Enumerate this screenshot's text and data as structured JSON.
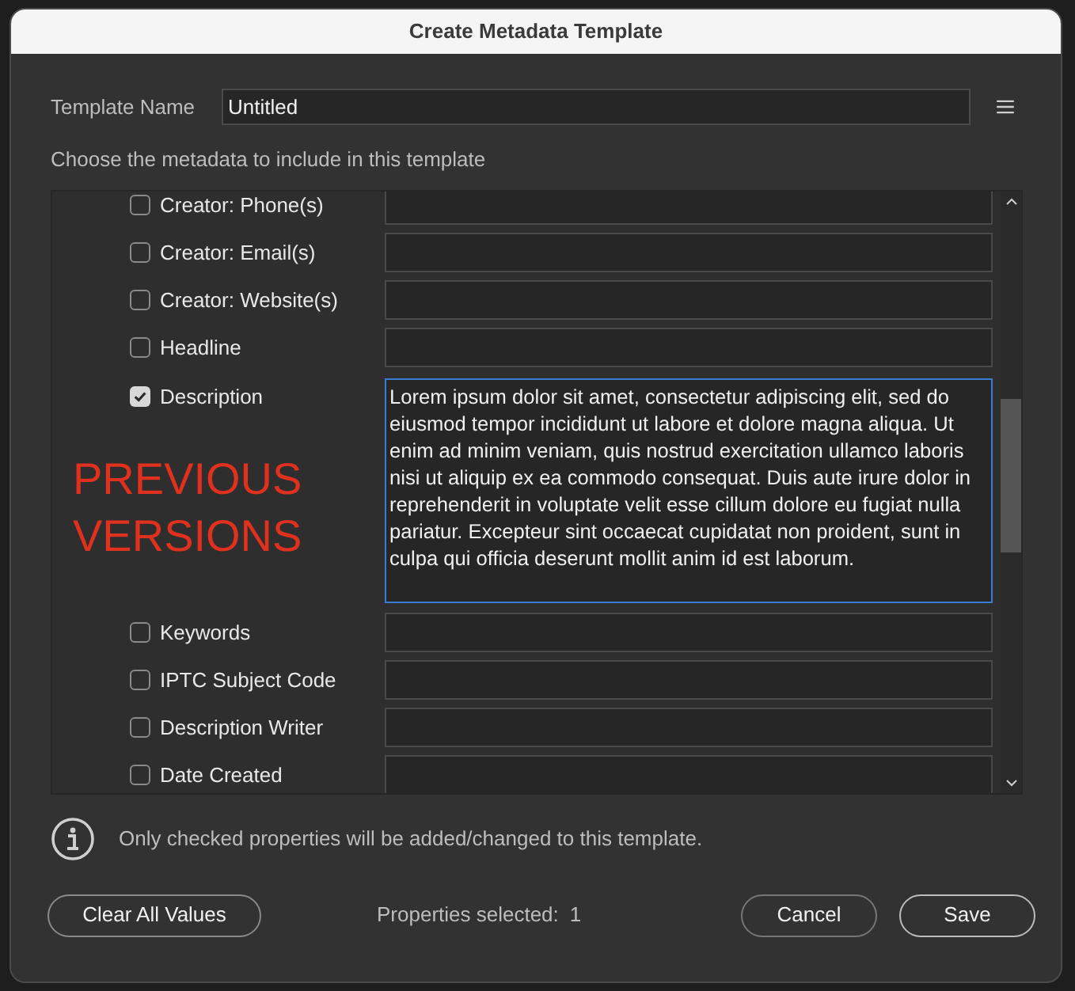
{
  "window": {
    "title": "Create Metadata Template"
  },
  "template_name": {
    "label": "Template Name",
    "value": "Untitled"
  },
  "instruction": "Choose the metadata to include in this template",
  "properties": [
    {
      "label": "Creator: Phone(s)",
      "checked": false
    },
    {
      "label": "Creator: Email(s)",
      "checked": false
    },
    {
      "label": "Creator: Website(s)",
      "checked": false
    },
    {
      "label": "Headline",
      "checked": false
    },
    {
      "label": "Description",
      "checked": true,
      "value": "Lorem ipsum dolor sit amet, consectetur adipiscing elit, sed do eiusmod tempor incididunt ut labore et dolore magna aliqua. Ut enim ad minim veniam, quis nostrud exercitation ullamco laboris nisi ut aliquip ex ea commodo consequat. Duis aute irure dolor in reprehenderit in voluptate velit esse cillum dolore eu fugiat nulla pariatur. Excepteur sint occaecat cupidatat non proident, sunt in culpa qui officia deserunt mollit anim id est laborum.",
      "annotation": "PREVIOUS VERSIONS"
    },
    {
      "label": "Keywords",
      "checked": false
    },
    {
      "label": "IPTC Subject Code",
      "checked": false
    },
    {
      "label": "Description Writer",
      "checked": false
    },
    {
      "label": "Date Created",
      "checked": false
    }
  ],
  "info": "Only checked properties will be added/changed to this template.",
  "buttons": {
    "clear": "Clear All Values",
    "cancel": "Cancel",
    "save": "Save"
  },
  "status": {
    "label": "Properties selected:",
    "count": "1"
  }
}
